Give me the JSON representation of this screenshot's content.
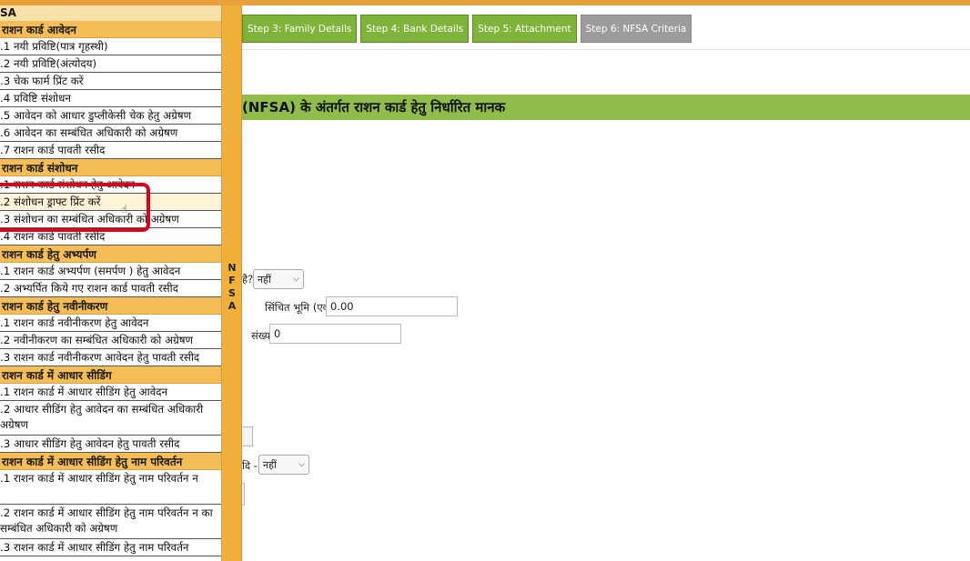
{
  "steps": [
    {
      "label": "Step 3: Family Details",
      "state": "done"
    },
    {
      "label": "Step 4: Bank Details",
      "state": "done"
    },
    {
      "label": "Step 5: Attachment",
      "state": "done"
    },
    {
      "label": "Step 6: NFSA Criteria",
      "state": "active"
    }
  ],
  "section_title": "(NFSA) के अंतर्गत राशन कार्ड हेतु निर्धारित मानक",
  "form": {
    "q1_label": "है?",
    "q1_value": "नहीं",
    "land_label": "सिंचित भूमि (एकड़ में)",
    "land_value": "0.00",
    "count_label": "संख्या",
    "count_value": "0",
    "q2_label": "दि -",
    "q2_value": "नहीं"
  },
  "sidebar": {
    "head": "SA",
    "tab_label": [
      "N",
      "F",
      "S",
      "A"
    ],
    "groups": [
      {
        "title": "राशन कार्ड आवेदन",
        "items": [
          ".1 नयी प्रविष्टि(पात्र गृहस्थी)",
          ".2 नयी प्रविष्टि(अंत्योदय)",
          ".3 चेक फार्म प्रिंट करें",
          ".4 प्रविष्टि संशोधन",
          ".5 आवेदन को आधार डुप्लीकेसी चेक हेतु अग्रेषण",
          ".6 आवेदन का सम्बंधित अधिकारी को अग्रेषण",
          ".7 राशन कार्ड पावती रसीद"
        ]
      },
      {
        "title": "राशन कार्ड संशोधन",
        "items": [
          ".1 राशन कार्ड संशोधन हेतु आवेदन",
          ".2 संशोधन ड्राफ्ट प्रिंट करें",
          ".3 संशोधन का सम्बंधित अधिकारी को अग्रेषण",
          ".4 राशन कार्ड पावती रसीद"
        ]
      },
      {
        "title": "राशन कार्ड हेतु अभ्यर्पण",
        "items": [
          ".1 राशन कार्ड अभ्यर्पण (समर्पण ) हेतु आवेदन",
          ".2 अभ्यर्पित किये गए राशन कार्ड पावती रसीद"
        ]
      },
      {
        "title": "राशन कार्ड हेतु नवीनीकरण",
        "items": [
          ".1 राशन कार्ड नवीनीकरण हेतु आवेदन",
          ".2 नवीनीकरण का सम्बंधित अधिकारी को अग्रेषण",
          ".3 राशन कार्ड नवीनीकरण आवेदन हेतु पावती रसीद"
        ]
      },
      {
        "title": "राशन कार्ड में आधार सीडिंग",
        "items": [
          ".1 राशन कार्ड में आधार सीडिंग हेतु आवेदन",
          ".2 आधार सीडिंग हेतु आवेदन का सम्बंधित अधिकारी अग्रेषण",
          ".3 आधार सीडिंग हेतु आवेदन हेतु पावती रसीद"
        ]
      },
      {
        "title": "राशन कार्ड में आधार सीडिंग हेतु नाम परिवर्तन",
        "items": [
          ".1 राशन कार्ड में आधार सीडिंग हेतु नाम परिवर्तन न",
          ".2 राशन कार्ड में आधार सीडिंग हेतु नाम परिवर्तन न का सम्बंधित अधिकारी को अग्रेषण",
          ".3 राशन कार्ड में आधार सीडिंग हेतु नाम परिवर्तन"
        ]
      }
    ]
  }
}
